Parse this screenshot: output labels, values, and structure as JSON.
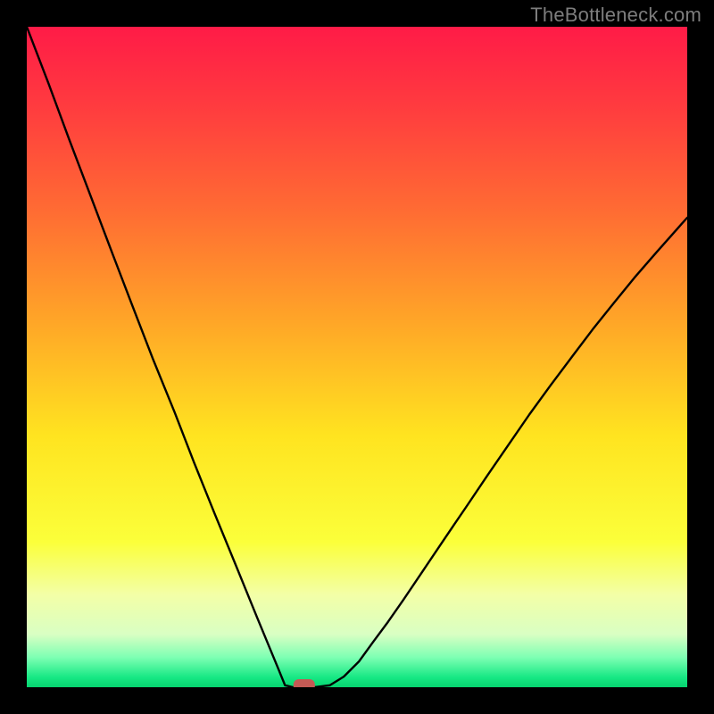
{
  "watermark": "TheBottleneck.com",
  "chart_data": {
    "type": "line",
    "title": "",
    "xlabel": "",
    "ylabel": "",
    "xlim": [
      0,
      1
    ],
    "ylim": [
      0,
      1
    ],
    "series": [
      {
        "name": "curve",
        "x": [
          0.0,
          0.033,
          0.064,
          0.097,
          0.128,
          0.159,
          0.191,
          0.224,
          0.253,
          0.284,
          0.316,
          0.349,
          0.38,
          0.391,
          0.403,
          0.414,
          0.436,
          0.459,
          0.48,
          0.503,
          0.524,
          0.547,
          0.57,
          0.601,
          0.634,
          0.666,
          0.697,
          0.73,
          0.761,
          0.793,
          0.826,
          0.857,
          0.889,
          0.92,
          0.953,
          0.984,
          1.0
        ],
        "y": [
          1.0,
          0.914,
          0.83,
          0.743,
          0.661,
          0.58,
          0.497,
          0.416,
          0.341,
          0.264,
          0.186,
          0.105,
          0.03,
          0.003,
          0.0,
          0.0,
          0.0,
          0.003,
          0.016,
          0.039,
          0.068,
          0.099,
          0.132,
          0.178,
          0.227,
          0.274,
          0.32,
          0.368,
          0.413,
          0.457,
          0.501,
          0.542,
          0.582,
          0.62,
          0.658,
          0.693,
          0.711
        ]
      }
    ],
    "marker": {
      "x": 0.42,
      "y": 0.0,
      "color": "#c45a55"
    },
    "gradient_stops": [
      {
        "offset": 0.0,
        "color": "#ff1b47"
      },
      {
        "offset": 0.12,
        "color": "#ff3b3f"
      },
      {
        "offset": 0.28,
        "color": "#ff6c33"
      },
      {
        "offset": 0.45,
        "color": "#ffa727"
      },
      {
        "offset": 0.62,
        "color": "#ffe420"
      },
      {
        "offset": 0.78,
        "color": "#fbff3a"
      },
      {
        "offset": 0.86,
        "color": "#f3ffa7"
      },
      {
        "offset": 0.92,
        "color": "#d9ffc3"
      },
      {
        "offset": 0.955,
        "color": "#7dffb3"
      },
      {
        "offset": 0.985,
        "color": "#17e884"
      },
      {
        "offset": 1.0,
        "color": "#06d46f"
      }
    ]
  }
}
